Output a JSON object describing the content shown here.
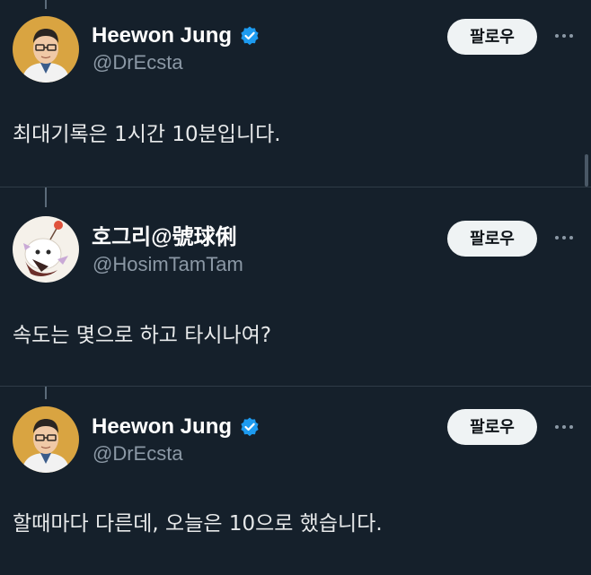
{
  "tweets": [
    {
      "display_name": "Heewon Jung",
      "verified": true,
      "handle": "@DrEcsta",
      "follow_label": "팔로우",
      "text": "최대기록은 1시간 10분입니다."
    },
    {
      "display_name": "호그리@號球俐",
      "verified": false,
      "handle": "@HosimTamTam",
      "follow_label": "팔로우",
      "text": "속도는 몇으로 하고 타시나여?"
    },
    {
      "display_name": "Heewon Jung",
      "verified": true,
      "handle": "@DrEcsta",
      "follow_label": "팔로우",
      "text": "할때마다 다른데, 오늘은 10으로 했습니다."
    }
  ],
  "icons": {
    "verified": "verified-badge-icon",
    "more": "more-options-icon"
  },
  "colors": {
    "background": "#15202b",
    "verified_blue": "#1d9bf0",
    "follow_button_bg": "#eff3f4",
    "secondary_text": "#8b98a5",
    "primary_text": "#e7e9ea"
  }
}
